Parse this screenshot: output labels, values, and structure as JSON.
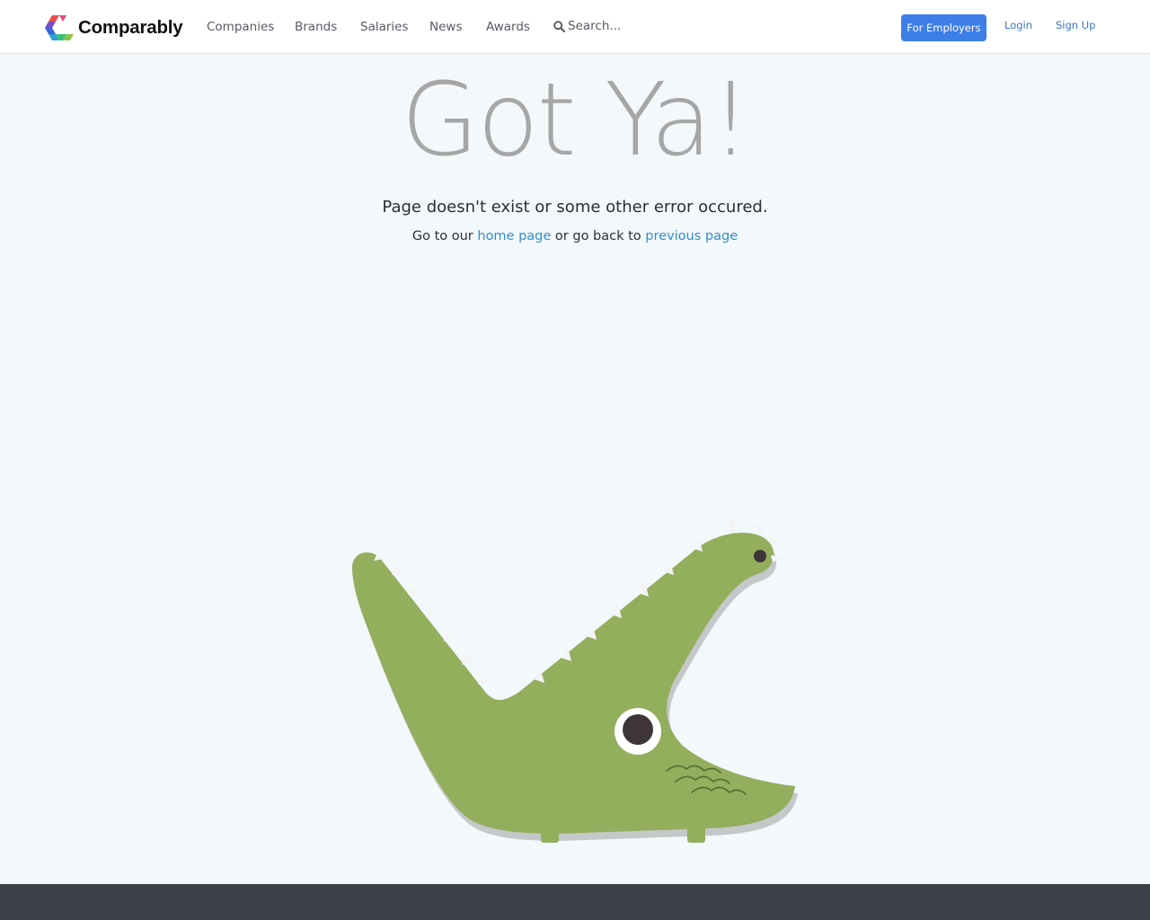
{
  "brand": {
    "name": "Comparably"
  },
  "nav": {
    "items": [
      {
        "label": "Companies"
      },
      {
        "label": "Brands"
      },
      {
        "label": "Salaries"
      },
      {
        "label": "News"
      },
      {
        "label": "Awards"
      }
    ],
    "search": {
      "placeholder": "Search..."
    },
    "for_employers": "For Employers",
    "login": "Login",
    "signup": "Sign Up"
  },
  "hero": {
    "title": "Got Ya!",
    "message": "Page doesn't exist or some other error occured.",
    "goto_prefix": "Go to our",
    "home_link": "home page",
    "goto_middle": "or go back to",
    "previous_link": "previous page"
  },
  "illustration": {
    "icon": "crocodile-icon"
  },
  "colors": {
    "accent": "#3d7ee8",
    "link": "#2f8fd1",
    "title": "#a6a6a6",
    "crocodile": "#93ae5d",
    "background": "#f3f8fb",
    "footer": "#3b4046"
  }
}
